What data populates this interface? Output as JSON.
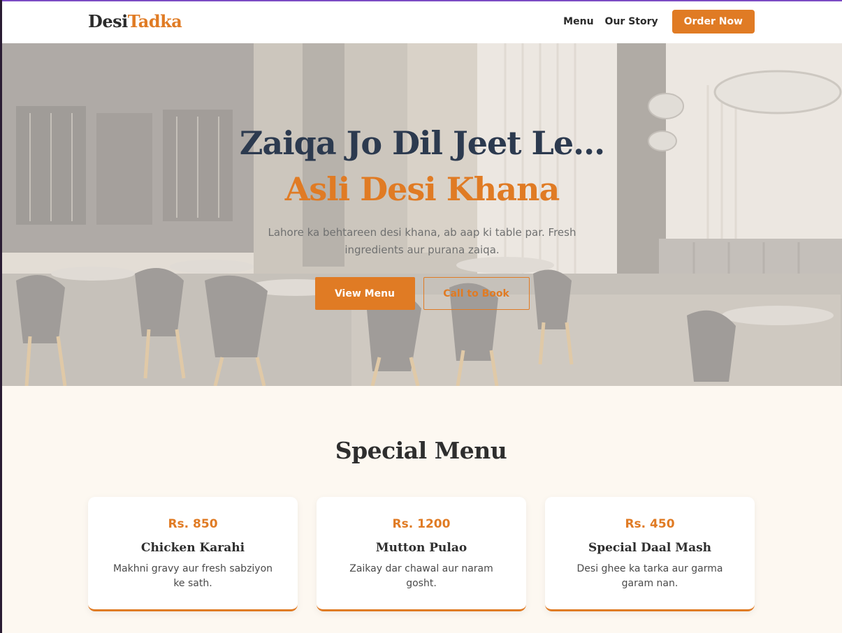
{
  "nav": {
    "logo_main": "Desi",
    "logo_accent": "Tadka",
    "links": [
      "Menu",
      "Our Story"
    ],
    "cta": "Order Now"
  },
  "hero": {
    "title_line1": "Zaiqa Jo Dil Jeet Le...",
    "title_line2": "Asli Desi Khana",
    "subtitle": "Lahore ka behtareen desi khana, ab aap ki table par. Fresh ingredients aur purana zaiqa.",
    "primary_button": "View Menu",
    "secondary_button": "Call to Book"
  },
  "special_menu": {
    "title": "Special Menu",
    "items": [
      {
        "price": "Rs. 850",
        "name": "Chicken Karahi",
        "description": "Makhni gravy aur fresh sabziyon ke sath."
      },
      {
        "price": "Rs. 1200",
        "name": "Mutton Pulao",
        "description": "Zaikay dar chawal aur naram gosht."
      },
      {
        "price": "Rs. 450",
        "name": "Special Daal Mash",
        "description": "Desi ghee ka tarka aur garma garam nan."
      }
    ]
  },
  "colors": {
    "accent": "#e07b24",
    "heading": "#2c3a4f",
    "background": "#fdf8f1"
  }
}
